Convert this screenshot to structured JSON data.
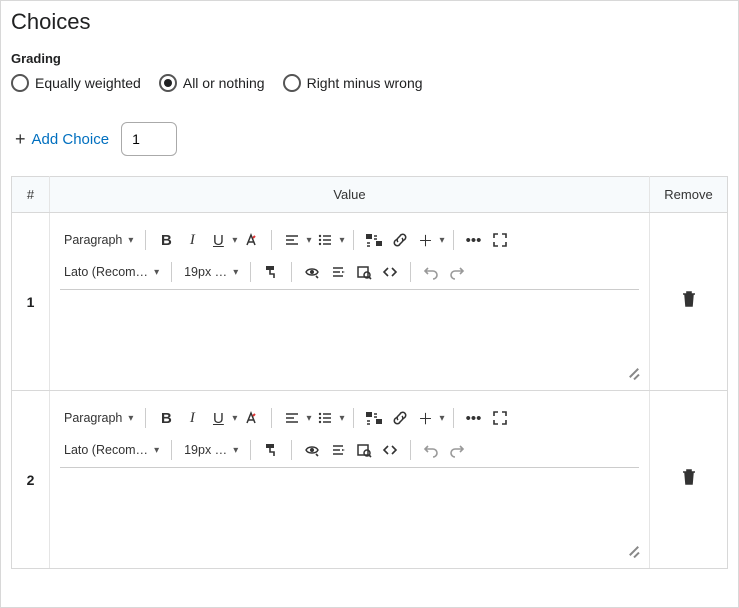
{
  "title": "Choices",
  "grading": {
    "label": "Grading",
    "options": [
      {
        "label": "Equally weighted",
        "selected": false
      },
      {
        "label": "All or nothing",
        "selected": true
      },
      {
        "label": "Right minus wrong",
        "selected": false
      }
    ]
  },
  "add_choice": {
    "label": "Add Choice",
    "qty": "1"
  },
  "table": {
    "headers": {
      "num": "#",
      "value": "Value",
      "remove": "Remove"
    },
    "rows": [
      {
        "num": "1",
        "content": ""
      },
      {
        "num": "2",
        "content": ""
      }
    ]
  },
  "rte": {
    "block_format": "Paragraph",
    "font_family": "Lato (Recom…",
    "font_size": "19px …"
  }
}
